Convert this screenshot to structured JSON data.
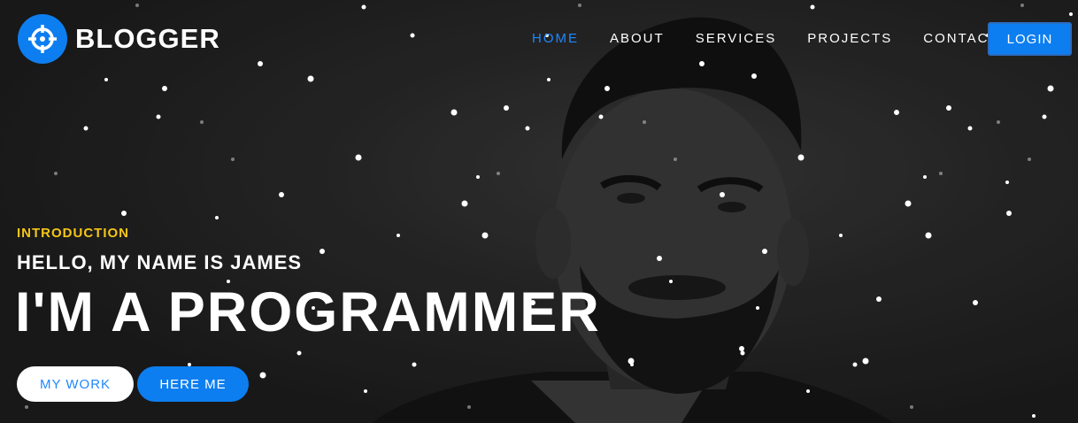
{
  "brand": {
    "name": "BLOGGER",
    "icon": "crosshair-icon",
    "accent": "#0d7ef0"
  },
  "nav": {
    "items": [
      {
        "label": "HOME",
        "active": true
      },
      {
        "label": "ABOUT"
      },
      {
        "label": "SERVICES"
      },
      {
        "label": "PROJECTS"
      },
      {
        "label": "CONTACT"
      }
    ],
    "login_label": "LOGIN"
  },
  "hero": {
    "eyebrow": "INTRODUCTION",
    "greeting": "HELLO, MY NAME IS JAMES",
    "headline": "I'M A PROGRAMMER",
    "primary_button": "MY WORK",
    "secondary_button": "HERE ME"
  },
  "colors": {
    "eyebrow": "#f5c518",
    "active_nav": "#1e88ff",
    "background": "#1f1f1f"
  }
}
